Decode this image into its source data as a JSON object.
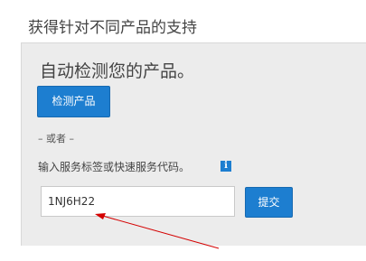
{
  "header": {
    "title": "获得针对不同产品的支持"
  },
  "panel": {
    "heading": "自动检测您的产品。",
    "detect_button_label": "检测产品",
    "or_text": "– 或者 –",
    "service_tag_label": "输入服务标签或快速服务代码。",
    "info_icon_glyph": "i",
    "service_tag_value": "1NJ6H22",
    "submit_button_label": "提交"
  },
  "colors": {
    "accent": "#1d7ed0",
    "panel_background": "#ececec",
    "annotation_arrow": "#d40000"
  },
  "icons": {
    "info": "info-icon",
    "annotation": "red-arrow-annotation"
  }
}
